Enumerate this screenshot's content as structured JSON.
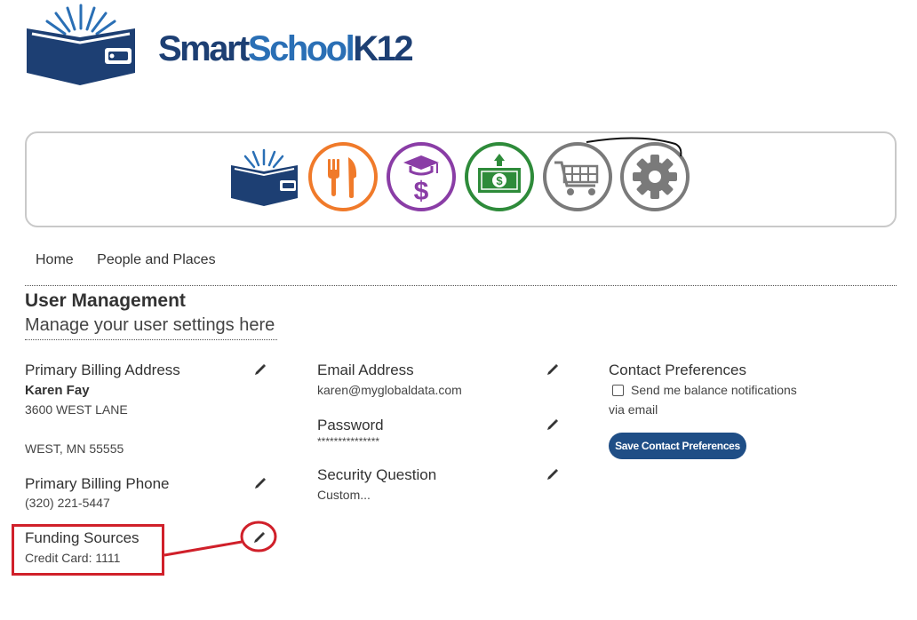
{
  "logo": {
    "part1": "Smart",
    "part2": "School",
    "part3": "K12"
  },
  "nav_icons": [
    {
      "name": "book-wallet-icon",
      "color": "#1d3f73"
    },
    {
      "name": "fork-knife-icon",
      "color": "#f07a2a"
    },
    {
      "name": "tuition-cap-dollar-icon",
      "color": "#8a3da6"
    },
    {
      "name": "money-bill-icon",
      "color": "#2e8b3a"
    },
    {
      "name": "shopping-cart-icon",
      "color": "#7a7a7a"
    },
    {
      "name": "gear-icon",
      "color": "#7a7a7a"
    }
  ],
  "breadcrumb": {
    "home": "Home",
    "people": "People and Places"
  },
  "page": {
    "title": "User Management",
    "subtitle": "Manage your user settings here"
  },
  "billing_address": {
    "label": "Primary Billing Address",
    "name": "Karen Fay",
    "line1": "3600 WEST LANE",
    "line2": "WEST, MN 55555"
  },
  "billing_phone": {
    "label": "Primary Billing Phone",
    "value": "(320) 221-5447"
  },
  "funding": {
    "label": "Funding Sources",
    "value": "Credit Card: 1111"
  },
  "email": {
    "label": "Email Address",
    "value": "karen@myglobaldata.com"
  },
  "password": {
    "label": "Password",
    "value": "***************"
  },
  "security": {
    "label": "Security Question",
    "value": "Custom..."
  },
  "contact": {
    "label": "Contact Preferences",
    "checkbox_label": "Send me balance notifications",
    "checkbox_label_2": "via email",
    "save_label": "Save Contact Preferences"
  },
  "colors": {
    "accent": "#1f4e86",
    "annotation": "#d0202a"
  }
}
